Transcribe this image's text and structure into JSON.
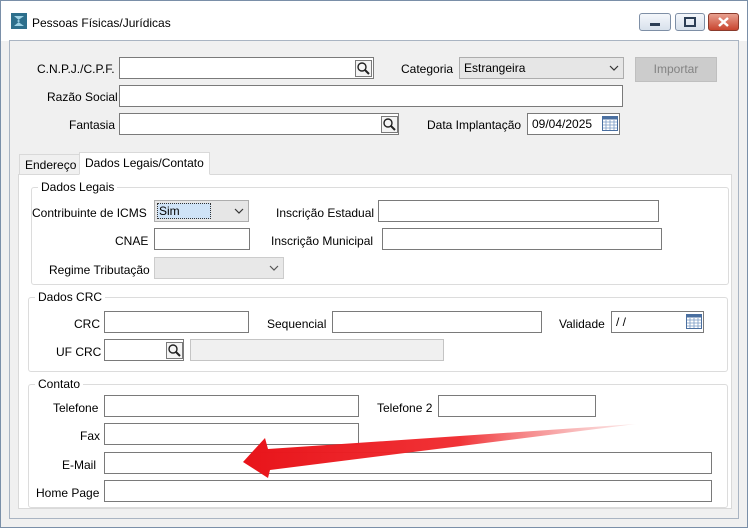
{
  "window": {
    "title": "Pessoas Físicas/Jurídicas",
    "icons": {
      "app": "app-logo-icon",
      "minimize": "minimize-icon",
      "maximize": "maximize-icon",
      "close": "close-icon"
    }
  },
  "header": {
    "cnpj_label": "C.N.P.J./C.P.F.",
    "cnpj_value": "",
    "categoria_label": "Categoria",
    "categoria_value": "Estrangeira",
    "importar_label": "Importar",
    "razao_label": "Razão Social",
    "razao_value": "",
    "fantasia_label": "Fantasia",
    "fantasia_value": "",
    "implantacao_label": "Data Implantação",
    "implantacao_value": "09/04/2025"
  },
  "tabs": [
    {
      "label": "Endereço",
      "active": false
    },
    {
      "label": "Dados Legais/Contato",
      "active": true
    }
  ],
  "dados_legais": {
    "title": "Dados Legais",
    "contribuinte_label": "Contribuinte de ICMS",
    "contribuinte_value": "Sim",
    "inscricao_estadual_label": "Inscrição Estadual",
    "inscricao_estadual_value": "",
    "cnae_label": "CNAE",
    "cnae_value": "",
    "inscricao_municipal_label": "Inscrição Municipal",
    "inscricao_municipal_value": "",
    "regime_label": "Regime Tributação",
    "regime_value": ""
  },
  "dados_crc": {
    "title": "Dados CRC",
    "crc_label": "CRC",
    "crc_value": "",
    "sequencial_label": "Sequencial",
    "sequencial_value": "",
    "validade_label": "Validade",
    "validade_value": " /  /",
    "uf_label": "UF CRC",
    "uf_value": "",
    "uf_desc_value": ""
  },
  "contato": {
    "title": "Contato",
    "telefone_label": "Telefone",
    "telefone_value": "",
    "telefone2_label": "Telefone 2",
    "telefone2_value": "",
    "fax_label": "Fax",
    "fax_value": "",
    "email_label": "E-Mail",
    "email_value": "",
    "homepage_label": "Home Page",
    "homepage_value": ""
  },
  "annotation": {
    "color": "#e8141a",
    "icon": "red-arrow-annotation"
  }
}
